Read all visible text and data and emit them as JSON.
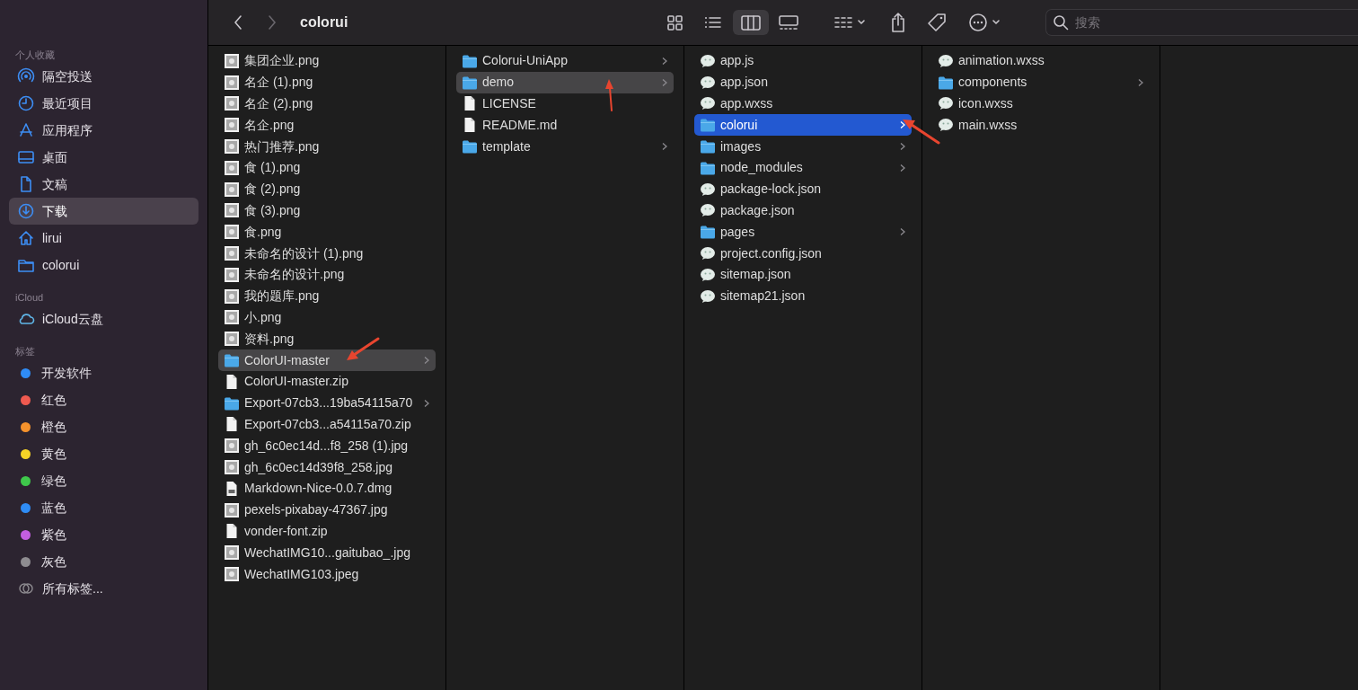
{
  "sidebar": {
    "sections": [
      {
        "header": "个人收藏",
        "items": [
          {
            "label": "隔空投送",
            "kind": "airdrop",
            "selected": false
          },
          {
            "label": "最近项目",
            "kind": "clock",
            "selected": false
          },
          {
            "label": "应用程序",
            "kind": "apps",
            "selected": false
          },
          {
            "label": "桌面",
            "kind": "desktop",
            "selected": false
          },
          {
            "label": "文稿",
            "kind": "document",
            "selected": false
          },
          {
            "label": "下载",
            "kind": "download",
            "selected": true
          },
          {
            "label": "lirui",
            "kind": "home",
            "selected": false
          },
          {
            "label": "colorui",
            "kind": "folder",
            "selected": false
          }
        ]
      },
      {
        "header": "iCloud",
        "items": [
          {
            "label": "iCloud云盘",
            "kind": "cloud",
            "selected": false
          }
        ]
      },
      {
        "header": "标签",
        "items": [
          {
            "label": "开发软件",
            "kind": "tag",
            "color": "#2f8cf5",
            "selected": false
          },
          {
            "label": "红色",
            "kind": "tag",
            "color": "#ef5a50",
            "selected": false
          },
          {
            "label": "橙色",
            "kind": "tag",
            "color": "#f5922c",
            "selected": false
          },
          {
            "label": "黄色",
            "kind": "tag",
            "color": "#f6d326",
            "selected": false
          },
          {
            "label": "绿色",
            "kind": "tag",
            "color": "#3fc84b",
            "selected": false
          },
          {
            "label": "蓝色",
            "kind": "tag",
            "color": "#2f8cf5",
            "selected": false
          },
          {
            "label": "紫色",
            "kind": "tag",
            "color": "#c35ee0",
            "selected": false
          },
          {
            "label": "灰色",
            "kind": "tag",
            "color": "#8e8c90",
            "selected": false
          },
          {
            "label": "所有标签...",
            "kind": "alltags",
            "selected": false
          }
        ]
      }
    ]
  },
  "toolbar": {
    "title": "colorui",
    "search": {
      "placeholder": "搜索"
    },
    "view_modes": [
      {
        "kind": "icons",
        "selected": false
      },
      {
        "kind": "list",
        "selected": false
      },
      {
        "kind": "columns",
        "selected": true
      },
      {
        "kind": "gallery",
        "selected": false
      }
    ]
  },
  "columns": [
    {
      "focused": false,
      "items": [
        {
          "name": "集团企业.png",
          "kind": "image",
          "has_children": false,
          "selected": false
        },
        {
          "name": "名企 (1).png",
          "kind": "image",
          "has_children": false,
          "selected": false
        },
        {
          "name": "名企 (2).png",
          "kind": "image",
          "has_children": false,
          "selected": false
        },
        {
          "name": "名企.png",
          "kind": "image",
          "has_children": false,
          "selected": false
        },
        {
          "name": "热门推荐.png",
          "kind": "image",
          "has_children": false,
          "selected": false
        },
        {
          "name": "食 (1).png",
          "kind": "image",
          "has_children": false,
          "selected": false
        },
        {
          "name": "食 (2).png",
          "kind": "image",
          "has_children": false,
          "selected": false
        },
        {
          "name": "食 (3).png",
          "kind": "image",
          "has_children": false,
          "selected": false
        },
        {
          "name": "食.png",
          "kind": "image",
          "has_children": false,
          "selected": false
        },
        {
          "name": "未命名的设计 (1).png",
          "kind": "image",
          "has_children": false,
          "selected": false
        },
        {
          "name": "未命名的设计.png",
          "kind": "image",
          "has_children": false,
          "selected": false
        },
        {
          "name": "我的题库.png",
          "kind": "image",
          "has_children": false,
          "selected": false
        },
        {
          "name": "小.png",
          "kind": "image",
          "has_children": false,
          "selected": false
        },
        {
          "name": "资料.png",
          "kind": "image",
          "has_children": false,
          "selected": false
        },
        {
          "name": "ColorUI-master",
          "kind": "folder",
          "has_children": true,
          "selected": true,
          "annotated": true
        },
        {
          "name": "ColorUI-master.zip",
          "kind": "file",
          "has_children": false,
          "selected": false
        },
        {
          "name": "Export-07cb3...19ba54115a70",
          "kind": "folder",
          "has_children": true,
          "selected": false
        },
        {
          "name": "Export-07cb3...a54115a70.zip",
          "kind": "file",
          "has_children": false,
          "selected": false
        },
        {
          "name": "gh_6c0ec14d...f8_258 (1).jpg",
          "kind": "image",
          "has_children": false,
          "selected": false
        },
        {
          "name": "gh_6c0ec14d39f8_258.jpg",
          "kind": "image",
          "has_children": false,
          "selected": false
        },
        {
          "name": "Markdown-Nice-0.0.7.dmg",
          "kind": "disk",
          "has_children": false,
          "selected": false
        },
        {
          "name": "pexels-pixabay-47367.jpg",
          "kind": "image",
          "has_children": false,
          "selected": false
        },
        {
          "name": "vonder-font.zip",
          "kind": "file",
          "has_children": false,
          "selected": false
        },
        {
          "name": "WechatIMG10...gaitubao_.jpg",
          "kind": "image",
          "has_children": false,
          "selected": false
        },
        {
          "name": "WechatIMG103.jpeg",
          "kind": "image",
          "has_children": false,
          "selected": false
        }
      ]
    },
    {
      "focused": false,
      "items": [
        {
          "name": "Colorui-UniApp",
          "kind": "folder",
          "has_children": true,
          "selected": false
        },
        {
          "name": "demo",
          "kind": "folder",
          "has_children": true,
          "selected": true,
          "annotated": true
        },
        {
          "name": "LICENSE",
          "kind": "file",
          "has_children": false,
          "selected": false
        },
        {
          "name": "README.md",
          "kind": "file",
          "has_children": false,
          "selected": false
        },
        {
          "name": "template",
          "kind": "folder",
          "has_children": true,
          "selected": false
        }
      ]
    },
    {
      "focused": true,
      "items": [
        {
          "name": "app.js",
          "kind": "bubble",
          "has_children": false,
          "selected": false
        },
        {
          "name": "app.json",
          "kind": "bubble",
          "has_children": false,
          "selected": false
        },
        {
          "name": "app.wxss",
          "kind": "bubble",
          "has_children": false,
          "selected": false
        },
        {
          "name": "colorui",
          "kind": "folder",
          "has_children": true,
          "selected": true,
          "annotated": true
        },
        {
          "name": "images",
          "kind": "folder",
          "has_children": true,
          "selected": false
        },
        {
          "name": "node_modules",
          "kind": "folder",
          "has_children": true,
          "selected": false
        },
        {
          "name": "package-lock.json",
          "kind": "bubble",
          "has_children": false,
          "selected": false
        },
        {
          "name": "package.json",
          "kind": "bubble",
          "has_children": false,
          "selected": false
        },
        {
          "name": "pages",
          "kind": "folder",
          "has_children": true,
          "selected": false
        },
        {
          "name": "project.config.json",
          "kind": "bubble",
          "has_children": false,
          "selected": false
        },
        {
          "name": "sitemap.json",
          "kind": "bubble",
          "has_children": false,
          "selected": false
        },
        {
          "name": "sitemap21.json",
          "kind": "bubble",
          "has_children": false,
          "selected": false
        }
      ]
    },
    {
      "items": [
        {
          "name": "animation.wxss",
          "kind": "bubble",
          "has_children": false,
          "selected": false
        },
        {
          "name": "components",
          "kind": "folder",
          "has_children": true,
          "selected": false
        },
        {
          "name": "icon.wxss",
          "kind": "bubble",
          "has_children": false,
          "selected": false
        },
        {
          "name": "main.wxss",
          "kind": "bubble",
          "has_children": false,
          "selected": false
        }
      ]
    }
  ]
}
